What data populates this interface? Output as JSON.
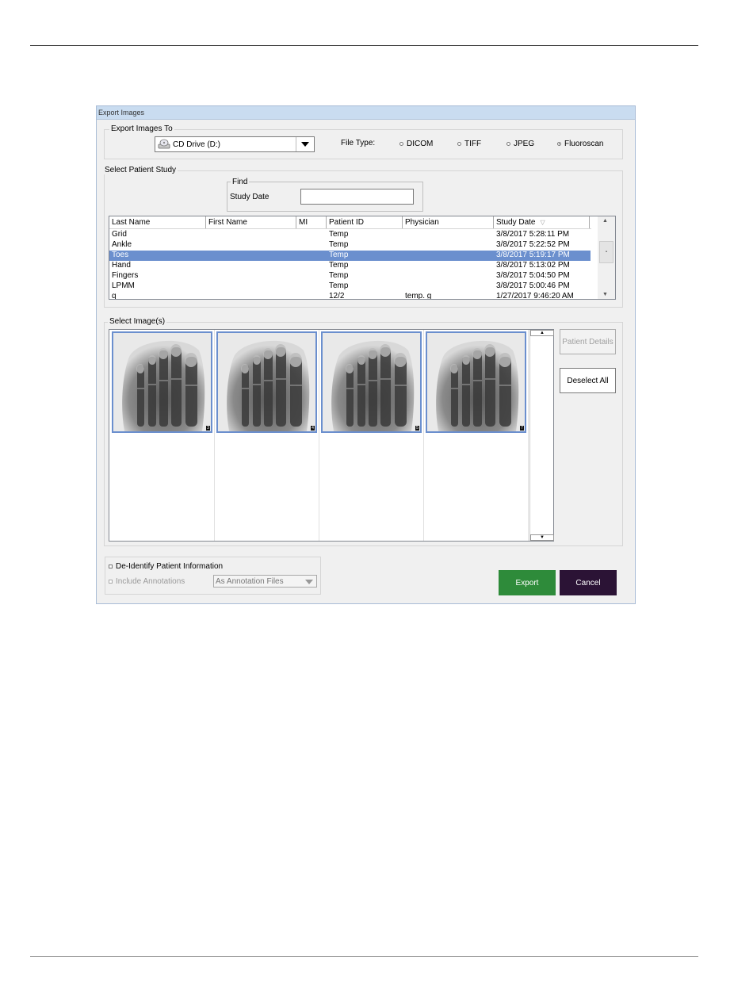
{
  "window": {
    "title": "Export Images"
  },
  "export_to": {
    "legend": "Export Images To",
    "drive": "CD Drive (D:)",
    "file_type_label": "File Type:",
    "file_types": [
      {
        "label": "DICOM",
        "selected": false
      },
      {
        "label": "TIFF",
        "selected": false
      },
      {
        "label": "JPEG",
        "selected": false
      },
      {
        "label": "Fluoroscan",
        "selected": true
      }
    ]
  },
  "study": {
    "legend": "Select Patient Study",
    "find_legend": "Find",
    "study_date_label": "Study Date",
    "study_date_value": "",
    "columns": [
      "Last Name",
      "First Name",
      "MI",
      "Patient ID",
      "Physician",
      "Study Date"
    ],
    "sort_indicator": "▽",
    "rows": [
      {
        "last": "Grid",
        "first": "",
        "mi": "",
        "pid": "Temp",
        "physician": "",
        "date": "3/8/2017 5:28:11 PM",
        "selected": false
      },
      {
        "last": "Ankle",
        "first": "",
        "mi": "",
        "pid": "Temp",
        "physician": "",
        "date": "3/8/2017 5:22:52 PM",
        "selected": false
      },
      {
        "last": "Toes",
        "first": "",
        "mi": "",
        "pid": "Temp",
        "physician": "",
        "date": "3/8/2017 5:19:17 PM",
        "selected": true
      },
      {
        "last": "Hand",
        "first": "",
        "mi": "",
        "pid": "Temp",
        "physician": "",
        "date": "3/8/2017 5:13:02 PM",
        "selected": false
      },
      {
        "last": "Fingers",
        "first": "",
        "mi": "",
        "pid": "Temp",
        "physician": "",
        "date": "3/8/2017 5:04:50 PM",
        "selected": false
      },
      {
        "last": "LPMM",
        "first": "",
        "mi": "",
        "pid": "Temp",
        "physician": "",
        "date": "3/8/2017 5:00:46 PM",
        "selected": false
      },
      {
        "last": "q",
        "first": "",
        "mi": "",
        "pid": "12/2",
        "physician": "temp. g",
        "date": "1/27/2017 9:46:20 AM",
        "selected": false
      }
    ]
  },
  "images": {
    "legend": "Select Image(s)",
    "thumbnails": [
      {
        "badge": "3",
        "selected": true
      },
      {
        "badge": "4",
        "selected": true
      },
      {
        "badge": "5",
        "selected": true
      },
      {
        "badge": "7",
        "selected": true
      }
    ],
    "patient_details_label": "Patient Details",
    "deselect_all_label": "Deselect All"
  },
  "options": {
    "deidentify_label": "De-Identify Patient Information",
    "deidentify_checked": false,
    "include_annotations_label": "Include Annotations",
    "include_annotations_checked": true,
    "annotation_mode": "As Annotation Files"
  },
  "actions": {
    "export_label": "Export",
    "cancel_label": "Cancel"
  },
  "colors": {
    "selection": "#6b8fce",
    "export": "#2e8b3a",
    "cancel": "#2b1335",
    "titlebar": "#c9dcf0"
  }
}
